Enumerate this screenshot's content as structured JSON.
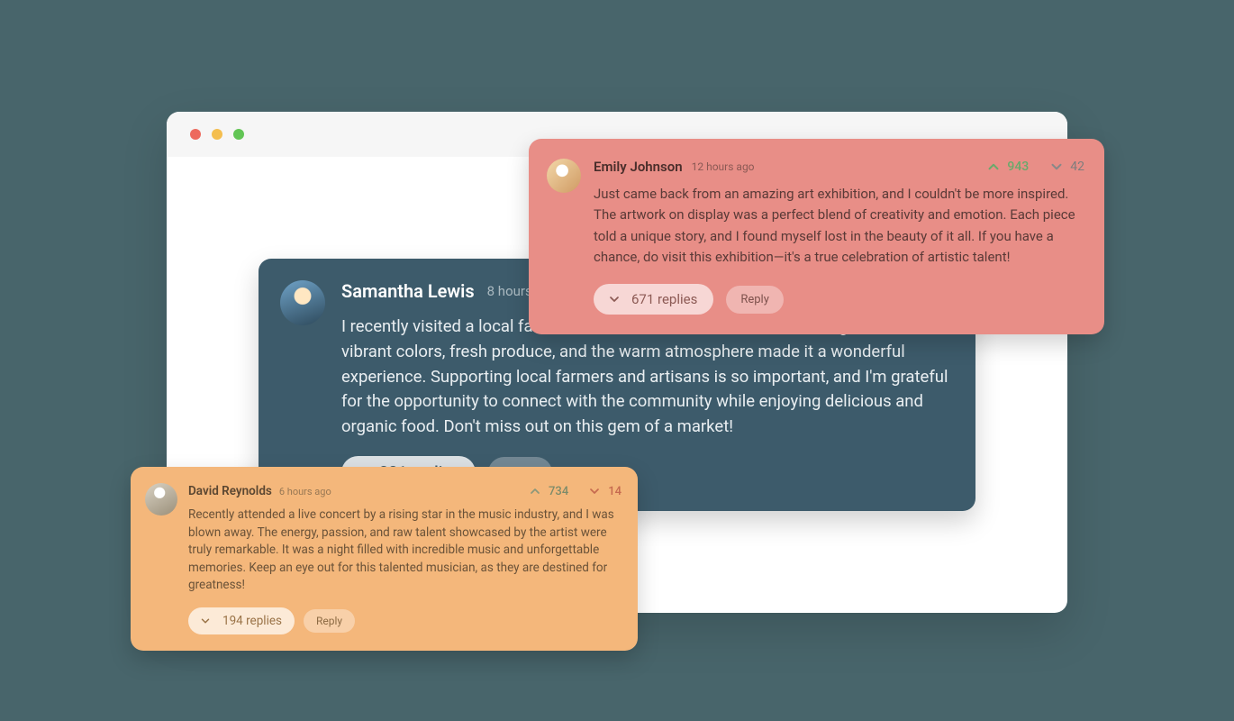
{
  "window": {
    "traffic_lights": [
      "close",
      "minimize",
      "maximize"
    ]
  },
  "main_comment": {
    "author": "Samantha Lewis",
    "timestamp": "8 hours ago",
    "body": "I recently visited a local farmer's market, and it was an absolute delight. The vibrant colors, fresh produce, and the warm atmosphere made it a wonderful experience. Supporting local farmers and artisans is so important, and I'm grateful for the opportunity to connect with the community while enjoying delicious and organic food. Don't miss out on this gem of a market!",
    "replies_label": "381 replies",
    "reply_label": "Reply"
  },
  "pink_comment": {
    "author": "Emily Johnson",
    "timestamp": "12 hours ago",
    "upvotes": "943",
    "downvotes": "42",
    "body": "Just came back from an amazing art exhibition, and I couldn't be more inspired. The artwork on display was a perfect blend of creativity and emotion. Each piece told a unique story, and I found myself lost in the beauty of it all. If you have a chance, do visit this exhibition—it's a true celebration of artistic talent!",
    "replies_label": "671 replies",
    "reply_label": "Reply"
  },
  "orange_comment": {
    "author": "David Reynolds",
    "timestamp": "6 hours ago",
    "upvotes": "734",
    "downvotes": "14",
    "body": "Recently attended a live concert by a rising star in the music industry, and I was blown away. The energy, passion, and raw talent showcased by the artist were truly remarkable. It was a night filled with incredible music and unforgettable memories. Keep an eye out for this talented musician, as they are destined for greatness!",
    "replies_label": "194 replies",
    "reply_label": "Reply"
  }
}
